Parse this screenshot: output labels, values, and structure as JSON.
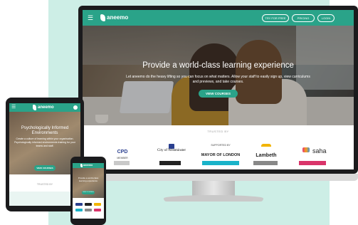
{
  "desktop": {
    "nav": {
      "logo": "aneemo",
      "buttons": [
        "TRY FOR FREE",
        "PRICING",
        "LOGIN"
      ]
    },
    "hero": {
      "title": "Provide a world-class learning experience",
      "body": "Let aneemo do the heavy lifting so you can focus on what matters. Allow your staff to easily sign up, view curriculums and previews, and take courses.",
      "cta": "VIEW COURSES"
    },
    "trusted_label": "TRUSTED BY",
    "logos": {
      "cpd": "CPD",
      "cpd_small": "MEMBER",
      "westminster": "City of Westminster",
      "mayor_small": "SUPPORTED BY",
      "mayor": "MAYOR OF LONDON",
      "lambeth": "Lambeth",
      "saha": "saha"
    }
  },
  "tablet": {
    "nav": {
      "logo": "aneemo"
    },
    "hero": {
      "title": "Psychologically Informed Environments",
      "body": "Create a culture of learning within your organisation. Psychologically informed environments training for your teams and staff.",
      "cta": "VIEW COURSES"
    },
    "trusted_label": "TRUSTED BY"
  },
  "phone": {
    "nav": {
      "logo": "aneemo"
    },
    "hero": {
      "title": "Provide a world-class learning experience",
      "cta": "VIEW COURSES"
    }
  },
  "colors": {
    "brand": "#2aa389",
    "background": "#cdeee6"
  }
}
